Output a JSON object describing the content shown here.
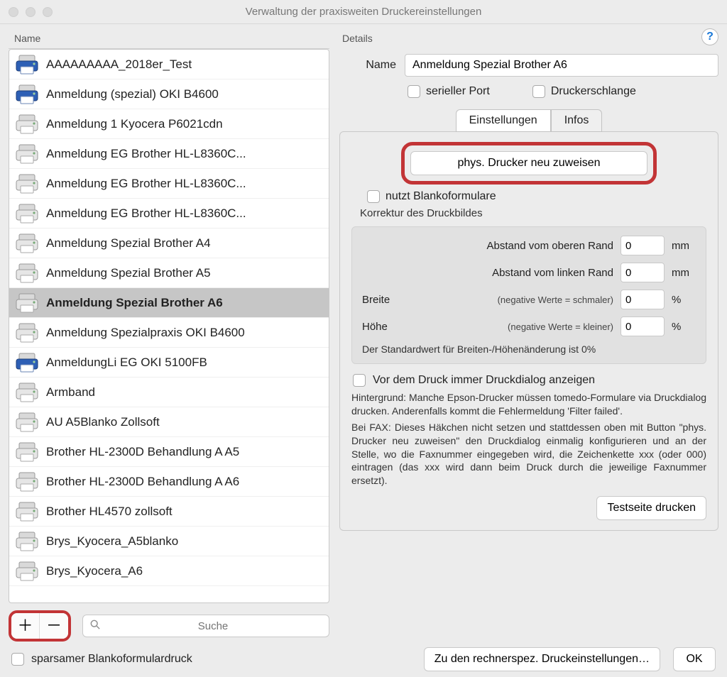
{
  "window": {
    "title": "Verwaltung der praxisweiten Druckereinstellungen"
  },
  "columns": {
    "name_header": "Name",
    "details_header": "Details"
  },
  "printers": [
    {
      "name": "AAAAAAAAA_2018er_Test",
      "color": "blue"
    },
    {
      "name": "Anmeldung (spezial) OKI B4600",
      "color": "blue"
    },
    {
      "name": "Anmeldung 1 Kyocera P6021cdn",
      "color": "gray"
    },
    {
      "name": "Anmeldung EG Brother HL-L8360C...",
      "color": "gray"
    },
    {
      "name": "Anmeldung EG Brother HL-L8360C...",
      "color": "gray"
    },
    {
      "name": "Anmeldung EG Brother HL-L8360C...",
      "color": "gray"
    },
    {
      "name": "Anmeldung Spezial Brother A4",
      "color": "gray"
    },
    {
      "name": "Anmeldung Spezial Brother A5",
      "color": "gray"
    },
    {
      "name": "Anmeldung Spezial Brother A6",
      "color": "gray",
      "selected": true
    },
    {
      "name": "Anmeldung Spezialpraxis OKI B4600",
      "color": "gray"
    },
    {
      "name": "AnmeldungLi EG OKI 5100FB",
      "color": "blue"
    },
    {
      "name": "Armband",
      "color": "gray"
    },
    {
      "name": "AU A5Blanko Zollsoft",
      "color": "gray"
    },
    {
      "name": "Brother HL-2300D Behandlung A A5",
      "color": "gray"
    },
    {
      "name": "Brother HL-2300D Behandlung A A6",
      "color": "gray"
    },
    {
      "name": "Brother HL4570 zollsoft",
      "color": "gray"
    },
    {
      "name": "Brys_Kyocera_A5blanko",
      "color": "gray"
    },
    {
      "name": "Brys_Kyocera_A6",
      "color": "gray"
    }
  ],
  "search": {
    "placeholder": "Suche"
  },
  "sparsam_label": "sparsamer Blankoformulardruck",
  "details": {
    "name_label": "Name",
    "name_value": "Anmeldung Spezial Brother A6",
    "serial_port_label": "serieller Port",
    "queue_label": "Druckerschlange",
    "tab_settings": "Einstellungen",
    "tab_infos": "Infos",
    "assign_button": "phys. Drucker neu zuweisen",
    "uses_blank_forms_label": "nutzt Blankoformulare",
    "correction_label": "Korrektur des Druckbildes",
    "top_margin_label": "Abstand vom oberen Rand",
    "left_margin_label": "Abstand vom linken Rand",
    "width_label": "Breite",
    "height_label": "Höhe",
    "width_note": "(negative Werte = schmaler)",
    "height_note": "(negative Werte = kleiner)",
    "unit_mm": "mm",
    "unit_percent": "%",
    "top_val": "0",
    "left_val": "0",
    "width_val": "0",
    "height_val": "0",
    "default_note": "Der Standardwert für Breiten-/Höhenänderung ist 0%",
    "before_print_label": "Vor dem Druck immer Druckdialog anzeigen",
    "helptext1": "Hintergrund: Manche Epson-Drucker müssen tomedo-Formulare via Druckdialog drucken. Anderenfalls kommt die Fehlermeldung 'Filter failed'.",
    "helptext2": "Bei FAX: Dieses Häkchen nicht setzen und stattdessen oben mit Button \"phys. Drucker neu zuweisen\" den Druckdialog einmalig konfigurieren und an der Stelle, wo die Faxnummer eingegeben wird, die Zeichenkette xxx (oder 000) eintragen (das xxx wird dann beim Druck durch die jeweilige Faxnummer ersetzt).",
    "testpage_button": "Testseite drucken"
  },
  "bottom": {
    "to_machine_settings": "Zu den rechnerspez. Druckeinstellungen…",
    "ok": "OK"
  }
}
